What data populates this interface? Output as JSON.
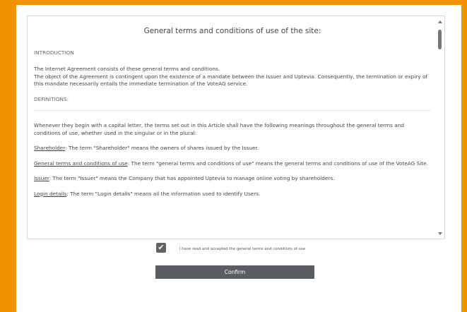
{
  "terms": {
    "title": "General terms and conditions of use of the site:",
    "introduction_heading": "INTRODUCTION",
    "intro_line1": "The Internet Agreement consists of these general terms and conditions.",
    "intro_line2": "The object of the Agreement is contingent upon the existence of a mandate between the Issuer and Uptevia. Consequently, the termination or expiry of this mandate necessarily entails the immediate termination of the VoteAG service.",
    "definitions_heading": "DEFINITIONS:",
    "definitions_intro": "Whenever they begin with a capital letter, the terms set out in this Article shall have the following meanings throughout the general terms and conditions of use, whether used in the singular or in the plural:",
    "definitions": [
      {
        "term": "Shareholder",
        "text": ": The term \"Shareholder\" means the owners of shares issued by the Issuer."
      },
      {
        "term": "General terms and conditions of use",
        "text": ": The term \"general terms and conditions of use\" means the general terms and conditions of use of the VoteAG Site."
      },
      {
        "term": "Issuer",
        "text": ": The term \"Issuer\" means the Company that has appointed Uptevia to manage online voting by shareholders."
      },
      {
        "term": "Login details",
        "text": ": The term \"Login details\" means all the information used to identify Users."
      }
    ]
  },
  "accept": {
    "checked": true,
    "check_glyph": "✔",
    "label": "I have read and accepted the general terms and conditions of use"
  },
  "confirm": {
    "label": "Confirm"
  },
  "colors": {
    "background": "#f39200",
    "button": "#5a5d61",
    "checkbox": "#5f6368"
  }
}
